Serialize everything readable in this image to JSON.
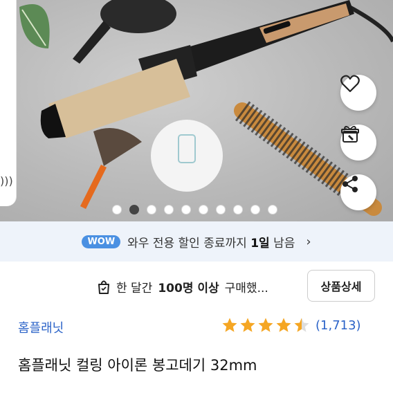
{
  "hero": {
    "slide_count": 10,
    "active_slide": 2,
    "icons": [
      "heart-icon",
      "gift-icon",
      "share-icon"
    ]
  },
  "wow": {
    "badge": "WOW",
    "text_prefix": "와우 전용 할인 종료까지",
    "text_bold": "1일",
    "text_suffix": "남음"
  },
  "purchase": {
    "prefix": "한 달간",
    "bold": "100명 이상",
    "suffix": "구매했...",
    "detail_button": "상품상세"
  },
  "product": {
    "brand": "홈플래닛",
    "rating": 4.5,
    "review_count": "(1,713)",
    "title": "홈플래닛 컬링 아이론 봉고데기 32mm"
  },
  "colors": {
    "link": "#2b63c8",
    "star": "#f5a623",
    "wow": "#4a90e2"
  }
}
